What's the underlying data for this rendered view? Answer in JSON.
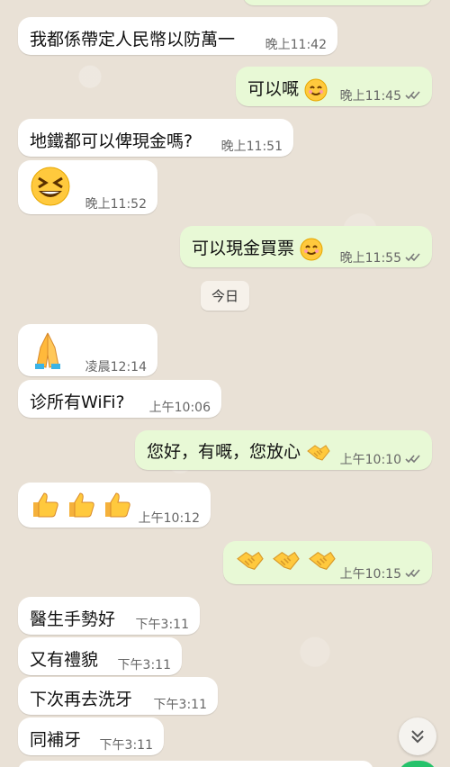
{
  "chat": {
    "day_label": "今日",
    "messages": [
      {
        "dir": "in",
        "text": "我都係帶定人民幣以防萬一",
        "time": "晚上11:42"
      },
      {
        "dir": "out",
        "text": "可以嘅",
        "time": "晚上11:45",
        "emoji": "smiling-face-emoji"
      },
      {
        "dir": "in",
        "text": "地鐵都可以俾現金嗎?",
        "time": "晚上11:51"
      },
      {
        "dir": "in",
        "text": "",
        "time": "晚上11:52",
        "emoji": "grinning-squinting-face-emoji"
      },
      {
        "dir": "out",
        "text": "可以現金買票",
        "time": "晚上11:55",
        "emoji": "smiling-face-emoji"
      },
      {
        "dir": "in",
        "text": "",
        "time": "凌晨12:14",
        "emoji": "folded-hands-emoji"
      },
      {
        "dir": "in",
        "text": "诊所有WiFi?",
        "time": "上午10:06"
      },
      {
        "dir": "out",
        "text": "您好，有嘅，您放心",
        "time": "上午10:10",
        "emoji": "handshake-emoji"
      },
      {
        "dir": "in",
        "text": "",
        "time": "上午10:12",
        "emoji": "thumbs-up-emoji-x3"
      },
      {
        "dir": "out",
        "text": "",
        "time": "上午10:15",
        "emoji": "handshake-emoji-x3"
      },
      {
        "dir": "in",
        "text": "醫生手勢好",
        "time": "下午3:11"
      },
      {
        "dir": "in",
        "text": "又有禮貌",
        "time": "下午3:11"
      },
      {
        "dir": "in",
        "text": "下次再去洗牙",
        "time": "下午3:11"
      },
      {
        "dir": "in",
        "text": "同補牙",
        "time": "下午3:11"
      }
    ]
  },
  "colors": {
    "incoming_bubble": "#ffffff",
    "outgoing_bubble": "#e8f9d6",
    "wallpaper": "#e9e1d6",
    "read_ticks": "#7a7a7a",
    "fab_green": "#25c26a"
  },
  "scroll_button_icon": "double-chevron-down-icon"
}
